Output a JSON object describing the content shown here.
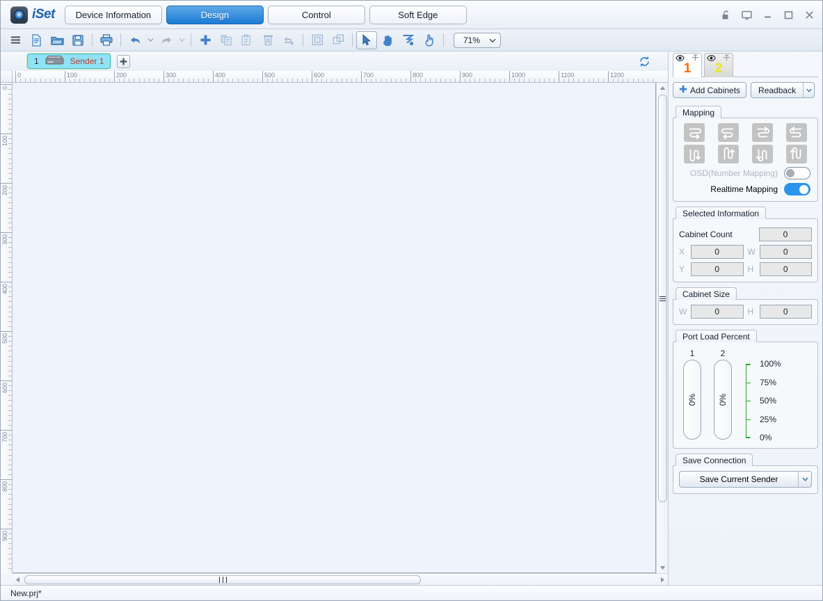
{
  "app": {
    "brand": "iSet",
    "brand_color": "#1b62ad"
  },
  "main_tabs": [
    {
      "label": "Device Information",
      "active": false
    },
    {
      "label": "Design",
      "active": true
    },
    {
      "label": "Control",
      "active": false
    },
    {
      "label": "Soft Edge",
      "active": false
    }
  ],
  "window_controls": [
    {
      "name": "lock-open-icon"
    },
    {
      "name": "screen-icon"
    },
    {
      "name": "minimize-icon"
    },
    {
      "name": "maximize-icon"
    },
    {
      "name": "close-icon"
    }
  ],
  "toolbar": {
    "items": [
      {
        "name": "menu-icon",
        "enabled": true
      },
      {
        "name": "new-file-icon",
        "enabled": true
      },
      {
        "name": "open-folder-icon",
        "enabled": true
      },
      {
        "name": "save-icon",
        "enabled": true
      },
      {
        "name": "print-icon",
        "enabled": true
      },
      {
        "name": "undo-icon",
        "enabled": true
      },
      {
        "name": "redo-icon",
        "enabled": false
      },
      {
        "name": "add-icon",
        "enabled": true
      },
      {
        "name": "copy-icon",
        "enabled": false
      },
      {
        "name": "paste-icon",
        "enabled": false
      },
      {
        "name": "delete-icon",
        "enabled": false
      },
      {
        "name": "unlink-icon",
        "enabled": false
      },
      {
        "name": "group-icon",
        "enabled": false
      },
      {
        "name": "ungroup-icon",
        "enabled": false
      },
      {
        "name": "select-tool-icon",
        "enabled": true
      },
      {
        "name": "pan-tool-icon",
        "enabled": true
      },
      {
        "name": "connect-tool-icon",
        "enabled": true
      },
      {
        "name": "hand-pointer-tool-icon",
        "enabled": true
      }
    ],
    "zoom_value": "71%"
  },
  "sender_bar": {
    "tab_index": "1",
    "tab_name": "Sender 1",
    "add_label": "+"
  },
  "rulers": {
    "horizontal_labels": [
      "0",
      "100",
      "200",
      "300",
      "400",
      "500",
      "600",
      "700",
      "800",
      "900",
      "1000",
      "1100",
      "1200"
    ],
    "vertical_labels": [
      "0",
      "100",
      "200",
      "300",
      "400",
      "500",
      "600",
      "700",
      "800",
      "900"
    ],
    "tick_spacing_px": 71
  },
  "right_panel": {
    "tabs": [
      {
        "number": "1",
        "color": "#ff6a00",
        "active": true,
        "eye": "eye-icon",
        "pin": "pin-icon"
      },
      {
        "number": "2",
        "color": "#e8e816",
        "active": false,
        "eye": "eye-icon",
        "pin": "pin-icon"
      }
    ],
    "add_cabinets_label": "Add Cabinets",
    "readback_label": "Readback",
    "mapping": {
      "title": "Mapping",
      "buttons": [
        "mapping-horizontal-s-1-icon",
        "mapping-horizontal-s-2-icon",
        "mapping-horizontal-s-3-icon",
        "mapping-horizontal-s-4-icon",
        "mapping-vertical-s-1-icon",
        "mapping-vertical-s-2-icon",
        "mapping-vertical-s-3-icon",
        "mapping-vertical-s-4-icon"
      ],
      "osd_label": "OSD(Number Mapping)",
      "osd_on": false,
      "realtime_label": "Realtime Mapping",
      "realtime_on": true
    },
    "selected_information": {
      "title": "Selected Information",
      "cabinet_count_label": "Cabinet Count",
      "cabinet_count_value": "0",
      "x_label": "X",
      "x_value": "0",
      "w_label": "W",
      "w_value": "0",
      "y_label": "Y",
      "y_value": "0",
      "h_label": "H",
      "h_value": "0"
    },
    "cabinet_size": {
      "title": "Cabinet Size",
      "w_label": "W",
      "w_value": "0",
      "h_label": "H",
      "h_value": "0"
    },
    "port_load": {
      "title": "Port Load Percent",
      "ports": [
        {
          "number": "1",
          "value": "0%"
        },
        {
          "number": "2",
          "value": "0%"
        }
      ],
      "scale_labels": [
        "100%",
        "75%",
        "50%",
        "25%",
        "0%"
      ],
      "scale_color": "#29a329"
    },
    "save_connection": {
      "title": "Save Connection",
      "button_label": "Save Current Sender"
    }
  },
  "status_bar": {
    "text": "New.prj*"
  }
}
